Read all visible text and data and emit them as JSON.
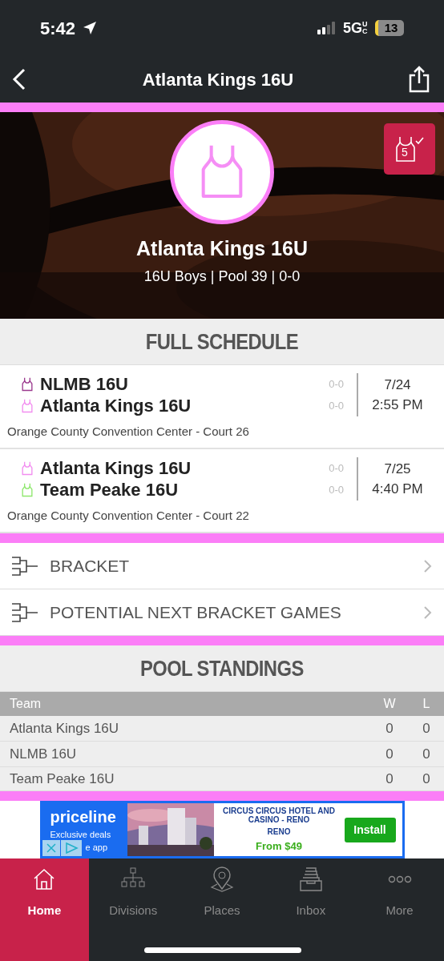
{
  "status_bar": {
    "time": "5:42",
    "network": "5G",
    "network_suffix": "UC",
    "battery": "13"
  },
  "nav": {
    "title": "Atlanta Kings 16U"
  },
  "hero": {
    "kind": "picture",
    "team": "Atlanta Kings 16U",
    "subtitle": "16U Boys | Pool 39 | 0-0",
    "badge_number": "5"
  },
  "schedule": {
    "title": "FULL SCHEDULE",
    "games": [
      {
        "teams": [
          {
            "name": "NLMB 16U",
            "record": "0-0",
            "color": "#9b3a8e"
          },
          {
            "name": "Atlanta Kings 16U",
            "record": "0-0",
            "color": "#f28ef0"
          }
        ],
        "date": "7/24",
        "time": "2:55 PM",
        "location": "Orange County Convention Center - Court 26"
      },
      {
        "teams": [
          {
            "name": "Atlanta Kings 16U",
            "record": "0-0",
            "color": "#f28ef0"
          },
          {
            "name": "Team Peake 16U",
            "record": "0-0",
            "color": "#8fe86e"
          }
        ],
        "date": "7/25",
        "time": "4:40 PM",
        "location": "Orange County Convention Center - Court 22"
      }
    ]
  },
  "links": [
    {
      "label": "BRACKET"
    },
    {
      "label": "POTENTIAL NEXT BRACKET GAMES"
    }
  ],
  "standings": {
    "title": "POOL STANDINGS",
    "columns": [
      "Team",
      "W",
      "L"
    ],
    "rows": [
      [
        "Atlanta Kings 16U",
        "0",
        "0"
      ],
      [
        "NLMB 16U",
        "0",
        "0"
      ],
      [
        "Team Peake 16U",
        "0",
        "0"
      ]
    ]
  },
  "ad": {
    "brand": "priceline",
    "tagline_1": "Exclusive deals",
    "tagline_2": "e app",
    "hotel": "CIRCUS CIRCUS HOTEL AND CASINO - RENO",
    "city": "RENO",
    "price": "From $49",
    "button": "Install"
  },
  "tabs": [
    {
      "label": "Home",
      "selected": true
    },
    {
      "label": "Divisions",
      "selected": false
    },
    {
      "label": "Places",
      "selected": false
    },
    {
      "label": "Inbox",
      "selected": false
    },
    {
      "label": "More",
      "selected": false
    }
  ]
}
